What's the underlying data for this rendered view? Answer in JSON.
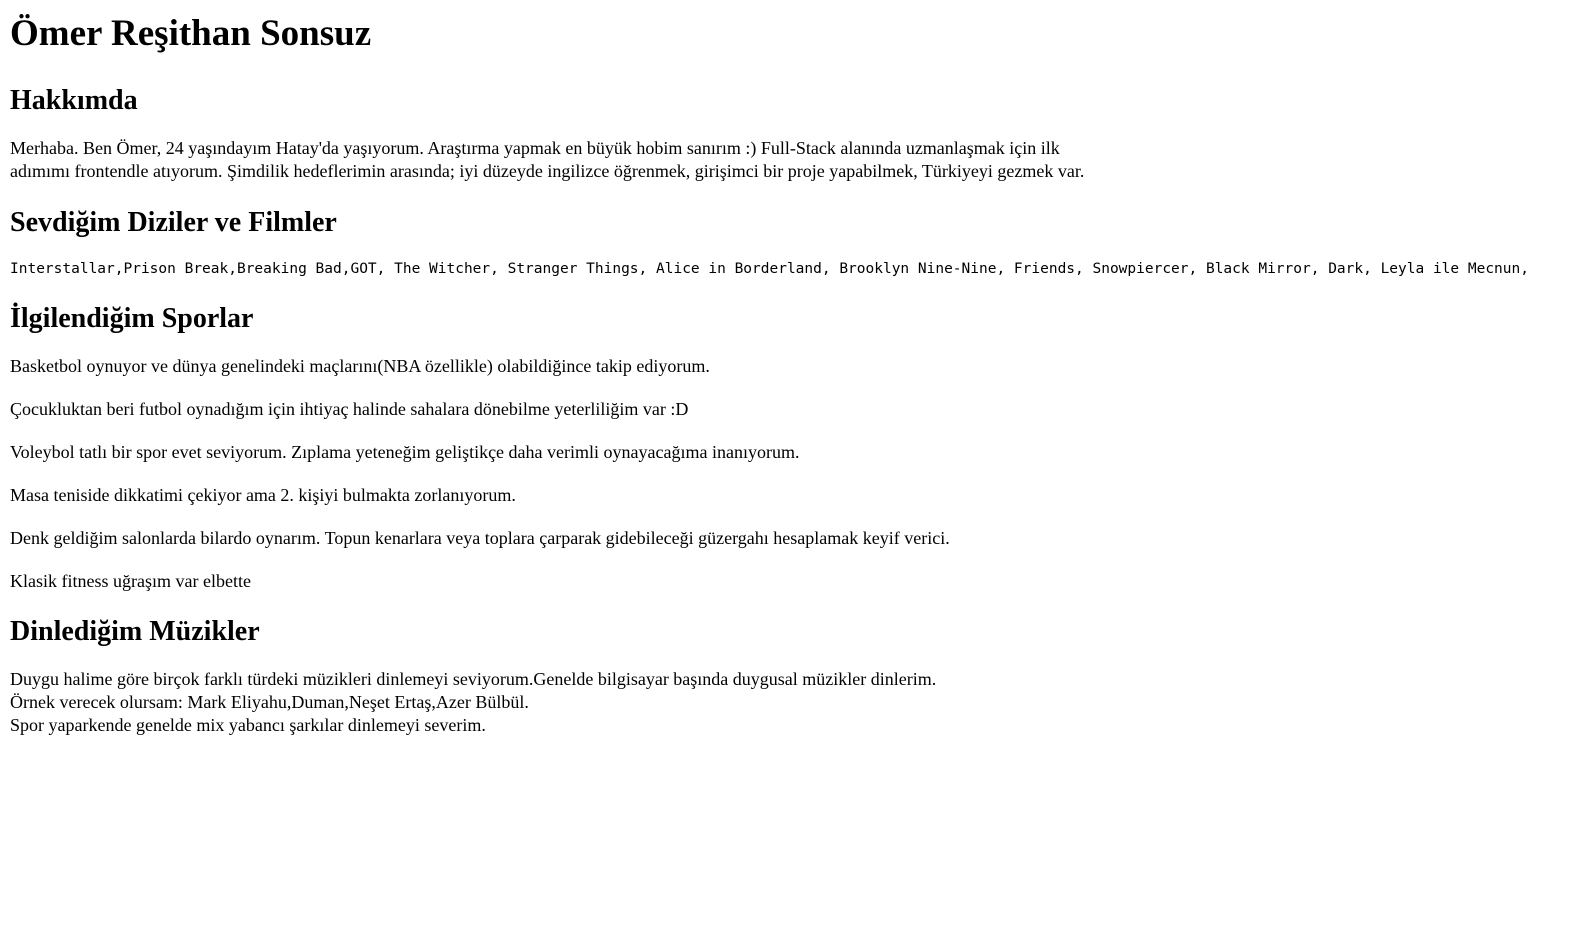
{
  "page": {
    "title": "Ömer Reşithan Sonsuz"
  },
  "about": {
    "heading": "Hakkımda",
    "lines": [
      "Merhaba. Ben Ömer, 24 yaşındayım Hatay'da yaşıyorum. Araştırma yapmak en büyük hobim sanırım :) Full-Stack alanında uzmanlaşmak için ilk",
      "adımımı frontendle atıyorum. Şimdilik hedeflerimin arasında; iyi düzeyde ingilizce öğrenmek, girişimci bir proje yapabilmek, Türkiyeyi gezmek var."
    ]
  },
  "films": {
    "heading": "Sevdiğim Diziler ve Filmler",
    "text": "Interstallar,Prison Break,Breaking Bad,GOT, The Witcher, Stranger Things, Alice in Borderland, Brooklyn Nine-Nine, Friends, Snowpiercer, Black Mirror, Dark, Leyla ile Mecnun,"
  },
  "sports": {
    "heading": "İlgilendiğim Sporlar",
    "items": [
      "Basketbol oynuyor ve dünya genelindeki maçlarını(NBA özellikle) olabildiğince takip ediyorum.",
      "Çocukluktan beri futbol oynadığım için ihtiyaç halinde sahalara dönebilme yeterliliğim var :D",
      "Voleybol tatlı bir spor evet seviyorum. Zıplama yeteneğim geliştikçe daha verimli oynayacağıma inanıyorum.",
      "Masa teniside dikkatimi çekiyor ama 2. kişiyi bulmakta zorlanıyorum.",
      "Denk geldiğim salonlarda bilardo oynarım. Topun kenarlara veya toplara çarparak gidebileceği güzergahı hesaplamak keyif verici.",
      "Klasik fitness uğraşım var elbette"
    ]
  },
  "music": {
    "heading": "Dinlediğim Müzikler",
    "lines": [
      "Duygu halime göre birçok farklı türdeki müzikleri dinlemeyi seviyorum.Genelde bilgisayar başında duygusal müzikler dinlerim.",
      "Örnek verecek olursam: Mark Eliyahu,Duman,Neşet Ertaş,Azer Bülbül.",
      "Spor yaparkende genelde mix yabancı şarkılar dinlemeyi severim."
    ]
  }
}
